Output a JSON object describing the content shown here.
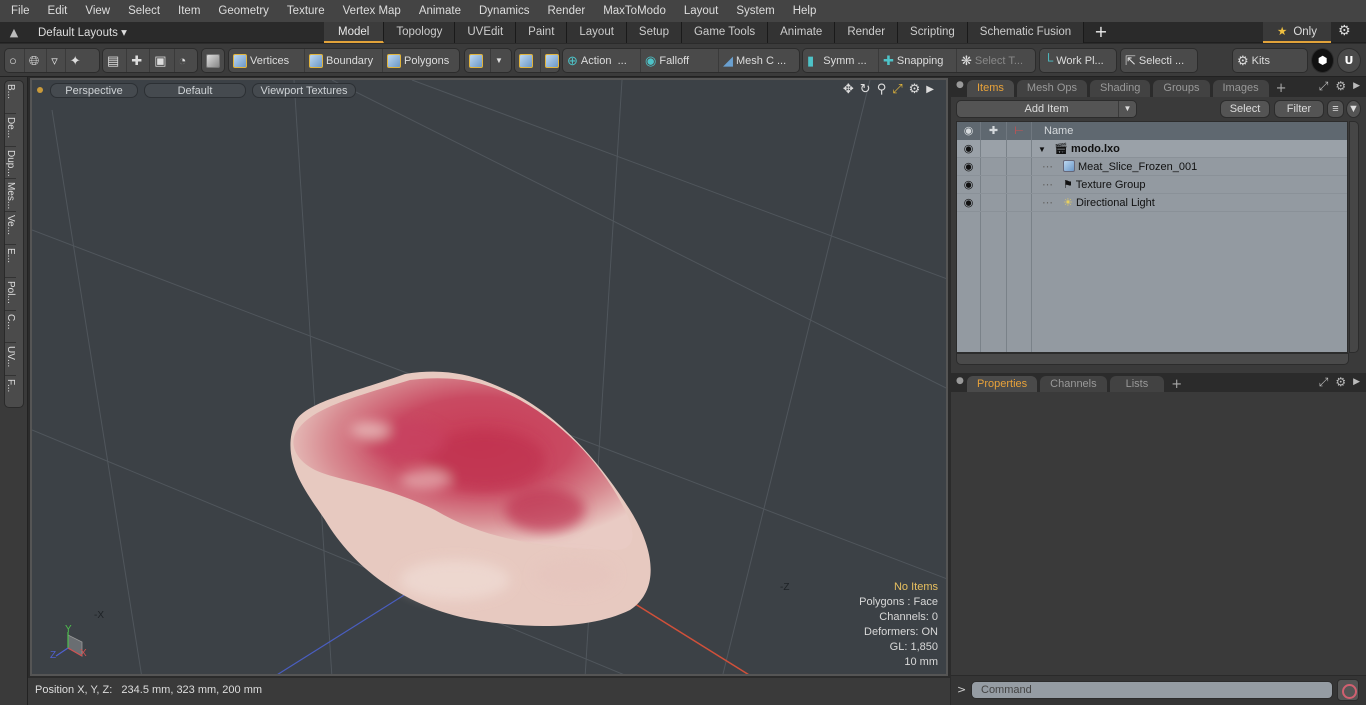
{
  "menubar": [
    "File",
    "Edit",
    "View",
    "Select",
    "Item",
    "Geometry",
    "Texture",
    "Vertex Map",
    "Animate",
    "Dynamics",
    "Render",
    "MaxToModo",
    "Layout",
    "System",
    "Help"
  ],
  "layoutbar": {
    "layouts_label": "Default Layouts",
    "tabs": [
      "Model",
      "Topology",
      "UVEdit",
      "Paint",
      "Layout",
      "Setup",
      "Game Tools",
      "Animate",
      "Render",
      "Scripting",
      "Schematic Fusion"
    ],
    "active_tab": "Model",
    "only_label": "Only"
  },
  "toolbar": {
    "vertices": "Vertices",
    "boundary": "Boundary",
    "polygons": "Polygons",
    "action": "Action",
    "falloff": "Falloff",
    "mesh_c": "Mesh C ...",
    "symm": "Symm ...",
    "snapping": "Snapping",
    "select_t": "Select T...",
    "work_pl": "Work Pl...",
    "selecti": "Selecti ...",
    "kits": "Kits",
    "ellipsis": "..."
  },
  "left_tabs": [
    "B...",
    "De...",
    "Dup...",
    "Mes...",
    "Ve...",
    "E...",
    "Pol...",
    "C...",
    "UV...",
    "F..."
  ],
  "viewport": {
    "view_mode": "Perspective",
    "shading": "Default",
    "textures": "Viewport Textures",
    "info": {
      "selection": "No Items",
      "polygons": "Polygons : Face",
      "channels": "Channels: 0",
      "deformers": "Deformers: ON",
      "gl": "GL: 1,850",
      "scale": "10 mm"
    },
    "axis_labels": {
      "neg_x": "-X",
      "neg_z": "-Z",
      "x": "X",
      "y": "Y",
      "z": "Z"
    }
  },
  "status": {
    "position_label": "Position X, Y, Z:",
    "position_value": "234.5 mm, 323 mm, 200 mm"
  },
  "items_panel": {
    "tabs": [
      "Items",
      "Mesh Ops",
      "Shading",
      "Groups",
      "Images"
    ],
    "active_tab": "Items",
    "add_item": "Add Item",
    "select": "Select",
    "filter": "Filter",
    "name_header": "Name",
    "tree": [
      {
        "name": "modo.lxo",
        "type": "scene",
        "level": 0
      },
      {
        "name": "Meat_Slice_Frozen_001",
        "type": "mesh",
        "level": 1
      },
      {
        "name": "Texture Group",
        "type": "texture-group",
        "level": 1
      },
      {
        "name": "Directional Light",
        "type": "light",
        "level": 1
      }
    ]
  },
  "properties_panel": {
    "tabs": [
      "Properties",
      "Channels",
      "Lists"
    ],
    "active_tab": "Properties"
  },
  "command": {
    "prompt": ">",
    "placeholder": "Command"
  },
  "colors": {
    "accent": "#e2a33a",
    "viewport_bg": "#3c4146",
    "tree_bg": "#939aa1"
  }
}
